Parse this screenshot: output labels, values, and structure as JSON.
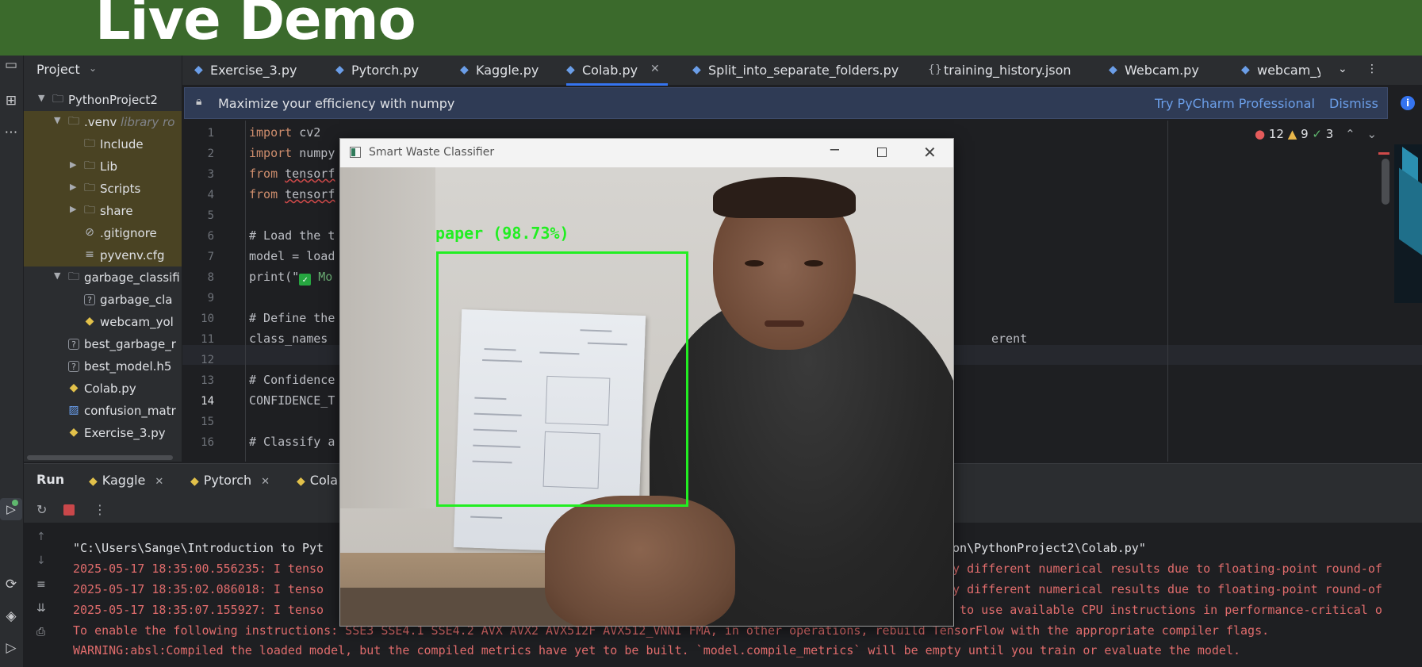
{
  "banner": {
    "title": "Live Demo"
  },
  "project": {
    "header": "Project",
    "tree": [
      {
        "label": "PythonProject2",
        "kind": "folder"
      },
      {
        "label": ".venv",
        "suffix": "library ro",
        "kind": "folder"
      },
      {
        "label": "Include",
        "kind": "folder"
      },
      {
        "label": "Lib",
        "kind": "folder"
      },
      {
        "label": "Scripts",
        "kind": "folder"
      },
      {
        "label": "share",
        "kind": "folder"
      },
      {
        "label": ".gitignore",
        "kind": "ignore"
      },
      {
        "label": "pyvenv.cfg",
        "kind": "config"
      },
      {
        "label": "garbage_classifi",
        "kind": "folder"
      },
      {
        "label": "garbage_cla",
        "kind": "unknown"
      },
      {
        "label": "webcam_yol",
        "kind": "python"
      },
      {
        "label": "best_garbage_r",
        "kind": "unknown"
      },
      {
        "label": "best_model.h5",
        "kind": "unknown"
      },
      {
        "label": "Colab.py",
        "kind": "python"
      },
      {
        "label": "confusion_matr",
        "kind": "image"
      },
      {
        "label": "Exercise_3.py",
        "kind": "python"
      }
    ]
  },
  "tabs": [
    {
      "label": "Exercise_3.py"
    },
    {
      "label": "Pytorch.py"
    },
    {
      "label": "Kaggle.py"
    },
    {
      "label": "Colab.py",
      "active": true
    },
    {
      "label": "Split_into_separate_folders.py"
    },
    {
      "label": "training_history.json"
    },
    {
      "label": "Webcam.py"
    },
    {
      "label": "webcam_yo"
    }
  ],
  "notification": {
    "message": "Maximize your efficiency with numpy",
    "action": "Try PyCharm Professional",
    "dismiss": "Dismiss"
  },
  "inspections": {
    "errors": "12",
    "warnings": "9",
    "ok": "3"
  },
  "editor": {
    "line_numbers": [
      "1",
      "2",
      "3",
      "4",
      "5",
      "6",
      "7",
      "8",
      "9",
      "10",
      "11",
      "12",
      "13",
      "14",
      "15",
      "16"
    ],
    "current_line": "14",
    "lines": {
      "l1_kw": "import",
      "l1_rest": " cv2",
      "l2_kw": "import",
      "l2_rest": " numpy",
      "l3_kw": "from",
      "l3_rest": "tensorf",
      "l4_kw": "from",
      "l4_rest": "tensorf",
      "l6": "# Load the t",
      "l7": "model = load",
      "l8_a": "print(\"",
      "l8_b": " Mo",
      "l10": "# Define the",
      "l11": "class_names",
      "l11_tail": "erent",
      "l13": "# Confidence",
      "l14": "CONFIDENCE_T",
      "l16": "# Classify a"
    }
  },
  "run": {
    "title": "Run",
    "tabs": [
      {
        "label": "Kaggle"
      },
      {
        "label": "Pytorch"
      },
      {
        "label": "Cola"
      }
    ],
    "output": [
      {
        "text": "\"C:\\Users\\Sange\\Introduction to Pyt",
        "color": "white"
      },
      {
        "text": "2025-05-17 18:35:00.556235: I tenso",
        "color": "red"
      },
      {
        "text": "2025-05-17 18:35:02.086018: I tenso",
        "color": "red"
      },
      {
        "text": "2025-05-17 18:35:07.155927: I tenso",
        "color": "red"
      },
      {
        "text": "To enable the following instructions: SSE3 SSE4.1 SSE4.2 AVX AVX2 AVX512F AVX512_VNNI FMA, in other operations, rebuild TensorFlow with the appropriate compiler flags.",
        "color": "red"
      },
      {
        "text": "WARNING:absl:Compiled the loaded model, but the compiled metrics have yet to be built. `model.compile_metrics` will be empty until you train or evaluate the model.",
        "color": "red"
      }
    ],
    "output_tails": [
      "hon\\PythonProject2\\Colab.py\"",
      "ly different numerical results due to floating-point round-of",
      "ly different numerical results due to floating-point round-of",
      "d to use available CPU instructions in performance-critical o"
    ]
  },
  "classifier_window": {
    "title": "Smart Waste Classifier",
    "detection_label": "paper (98.73%)"
  },
  "colors": {
    "banner": "#3b6a2c",
    "detection": "#22ee22",
    "error_text": "#e06c6c",
    "accent": "#3574f0"
  }
}
